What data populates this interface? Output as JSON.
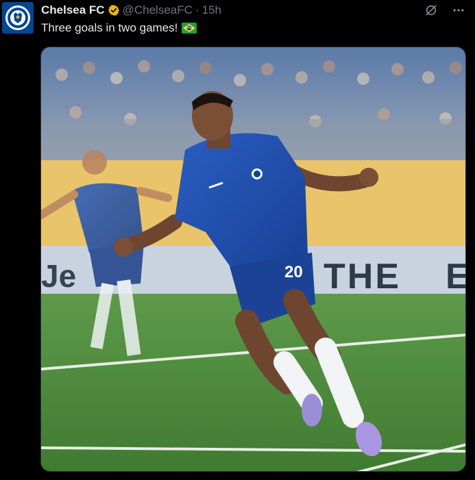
{
  "tweet": {
    "author_name": "Chelsea FC",
    "handle": "@ChelseaFC",
    "separator": "·",
    "time": "15h",
    "text": "Three goals in two games!",
    "flag_icon": "brazil-flag-icon",
    "verified_icon": "verified-badge-icon",
    "avatar_icon": "chelsea-crest-icon",
    "media_alt": "Chelsea player celebrating"
  },
  "banner_text": "THE",
  "jersey_number": "20",
  "colors": {
    "background": "#000000",
    "text_primary": "#e7e9ea",
    "text_secondary": "#71767b",
    "verified_gold": "#e2b719",
    "chelsea_blue": "#034694"
  }
}
